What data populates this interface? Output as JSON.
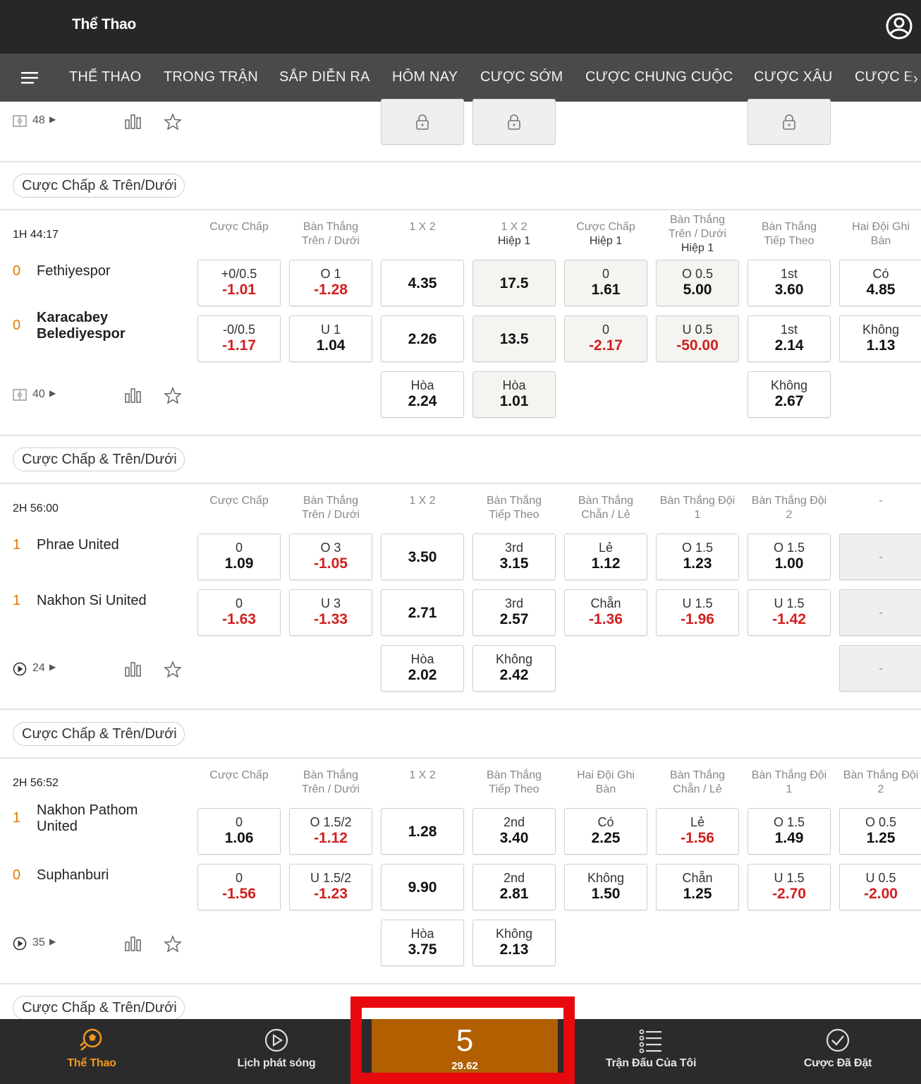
{
  "header": {
    "title": "Thể Thao"
  },
  "nav": {
    "items": [
      "THỂ THAO",
      "TRONG TRẬN",
      "SẮP DIỄN RA",
      "HÔM NAY",
      "CƯỢC SỚM",
      "CƯỢC CHUNG CUỘC",
      "CƯỢC XÂU",
      "CƯỢC E"
    ]
  },
  "top_partial": {
    "count": "48"
  },
  "pill_label": "Cược Chấp & Trên/Dưới",
  "matches": [
    {
      "time": "1H 44:17",
      "headers": [
        [
          "Cược Chấp",
          ""
        ],
        [
          "Bàn Thắng",
          "Trên / Dưới"
        ],
        [
          "1 X 2",
          ""
        ],
        [
          "1 X 2",
          "Hiệp 1"
        ],
        [
          "Cược Chấp",
          "Hiệp 1"
        ],
        [
          "Bàn Thắng",
          "Trên / Dưới",
          "Hiệp 1"
        ],
        [
          "Bàn Thắng",
          "Tiếp Theo"
        ],
        [
          "Hai Đội Ghi",
          "Bàn"
        ]
      ],
      "home": {
        "score": "0",
        "name": "Fethiyespor"
      },
      "away": {
        "score": "0",
        "name": "Karacabey",
        "name2": "Belediyespor"
      },
      "count": "40",
      "home_odds": [
        [
          "+0/0.5",
          "-1.01"
        ],
        [
          "O 1",
          "-1.28"
        ],
        [
          "",
          "4.35"
        ],
        [
          "",
          "17.5"
        ],
        [
          "0",
          "1.61"
        ],
        [
          "O 0.5",
          "5.00"
        ],
        [
          "1st",
          "3.60"
        ],
        [
          "Có",
          "4.85"
        ]
      ],
      "away_odds": [
        [
          "-0/0.5",
          "-1.17"
        ],
        [
          "U 1",
          "1.04"
        ],
        [
          "",
          "2.26"
        ],
        [
          "",
          "13.5"
        ],
        [
          "0",
          "-2.17"
        ],
        [
          "U 0.5",
          "-50.00"
        ],
        [
          "1st",
          "2.14"
        ],
        [
          "Không",
          "1.13"
        ]
      ],
      "draw_odds": [
        [
          "Hòa",
          "2.24"
        ],
        [
          "Hòa",
          "1.01"
        ],
        [
          "Không",
          "2.67"
        ]
      ]
    },
    {
      "time": "2H 56:00",
      "headers": [
        [
          "Cược Chấp",
          ""
        ],
        [
          "Bàn Thắng",
          "Trên / Dưới"
        ],
        [
          "1 X 2",
          ""
        ],
        [
          "Bàn Thắng",
          "Tiếp Theo"
        ],
        [
          "Bàn Thắng",
          "Chẵn / Lẻ"
        ],
        [
          "Bàn Thắng Đội",
          "1"
        ],
        [
          "Bàn Thắng Đội",
          "2"
        ],
        [
          "-",
          ""
        ]
      ],
      "home": {
        "score": "1",
        "name": "Phrae United"
      },
      "away": {
        "score": "1",
        "name": "Nakhon Si United"
      },
      "count": "24",
      "home_odds": [
        [
          "0",
          "1.09"
        ],
        [
          "O 3",
          "-1.05"
        ],
        [
          "",
          "3.50"
        ],
        [
          "3rd",
          "3.15"
        ],
        [
          "Lẻ",
          "1.12"
        ],
        [
          "O 1.5",
          "1.23"
        ],
        [
          "O 1.5",
          "1.00"
        ],
        [
          "-",
          ""
        ]
      ],
      "away_odds": [
        [
          "0",
          "-1.63"
        ],
        [
          "U 3",
          "-1.33"
        ],
        [
          "",
          "2.71"
        ],
        [
          "3rd",
          "2.57"
        ],
        [
          "Chẵn",
          "-1.36"
        ],
        [
          "U 1.5",
          "-1.96"
        ],
        [
          "U 1.5",
          "-1.42"
        ],
        [
          "-",
          ""
        ]
      ],
      "draw_odds": [
        [
          "Hòa",
          "2.02"
        ],
        [
          "Không",
          "2.42"
        ],
        [
          "-",
          ""
        ]
      ]
    },
    {
      "time": "2H 56:52",
      "headers": [
        [
          "Cược Chấp",
          ""
        ],
        [
          "Bàn Thắng",
          "Trên / Dưới"
        ],
        [
          "1 X 2",
          ""
        ],
        [
          "Bàn Thắng",
          "Tiếp Theo"
        ],
        [
          "Hai Đội Ghi",
          "Bàn"
        ],
        [
          "Bàn Thắng",
          "Chẵn / Lẻ"
        ],
        [
          "Bàn Thắng Đội",
          "1"
        ],
        [
          "Bàn Thắng Đội",
          "2"
        ]
      ],
      "home": {
        "score": "1",
        "name": "Nakhon Pathom",
        "name2": "United"
      },
      "away": {
        "score": "0",
        "name": "Suphanburi"
      },
      "count": "35",
      "home_odds": [
        [
          "0",
          "1.06"
        ],
        [
          "O 1.5/2",
          "-1.12"
        ],
        [
          "",
          "1.28"
        ],
        [
          "2nd",
          "3.40"
        ],
        [
          "Có",
          "2.25"
        ],
        [
          "Lẻ",
          "-1.56"
        ],
        [
          "O 1.5",
          "1.49"
        ],
        [
          "O 0.5",
          "1.25"
        ]
      ],
      "away_odds": [
        [
          "0",
          "-1.56"
        ],
        [
          "U 1.5/2",
          "-1.23"
        ],
        [
          "",
          "9.90"
        ],
        [
          "2nd",
          "2.81"
        ],
        [
          "Không",
          "1.50"
        ],
        [
          "Chẵn",
          "1.25"
        ],
        [
          "U 1.5",
          "-2.70"
        ],
        [
          "U 0.5",
          "-2.00"
        ]
      ],
      "draw_odds": [
        [
          "Hòa",
          "3.75"
        ],
        [
          "Không",
          "2.13"
        ]
      ]
    }
  ],
  "bottom": {
    "tabs": [
      "Thể Thao",
      "Lịch phát sóng",
      "Trận Đấu Của Tôi",
      "Cược Đã Đặt"
    ],
    "betslip_count": "5",
    "betslip_value": "29.62"
  },
  "colors": {
    "accent": "#f39a1f",
    "betslip": "#b15f00",
    "negative": "#d21f1f",
    "highlight": "#e8090f"
  }
}
